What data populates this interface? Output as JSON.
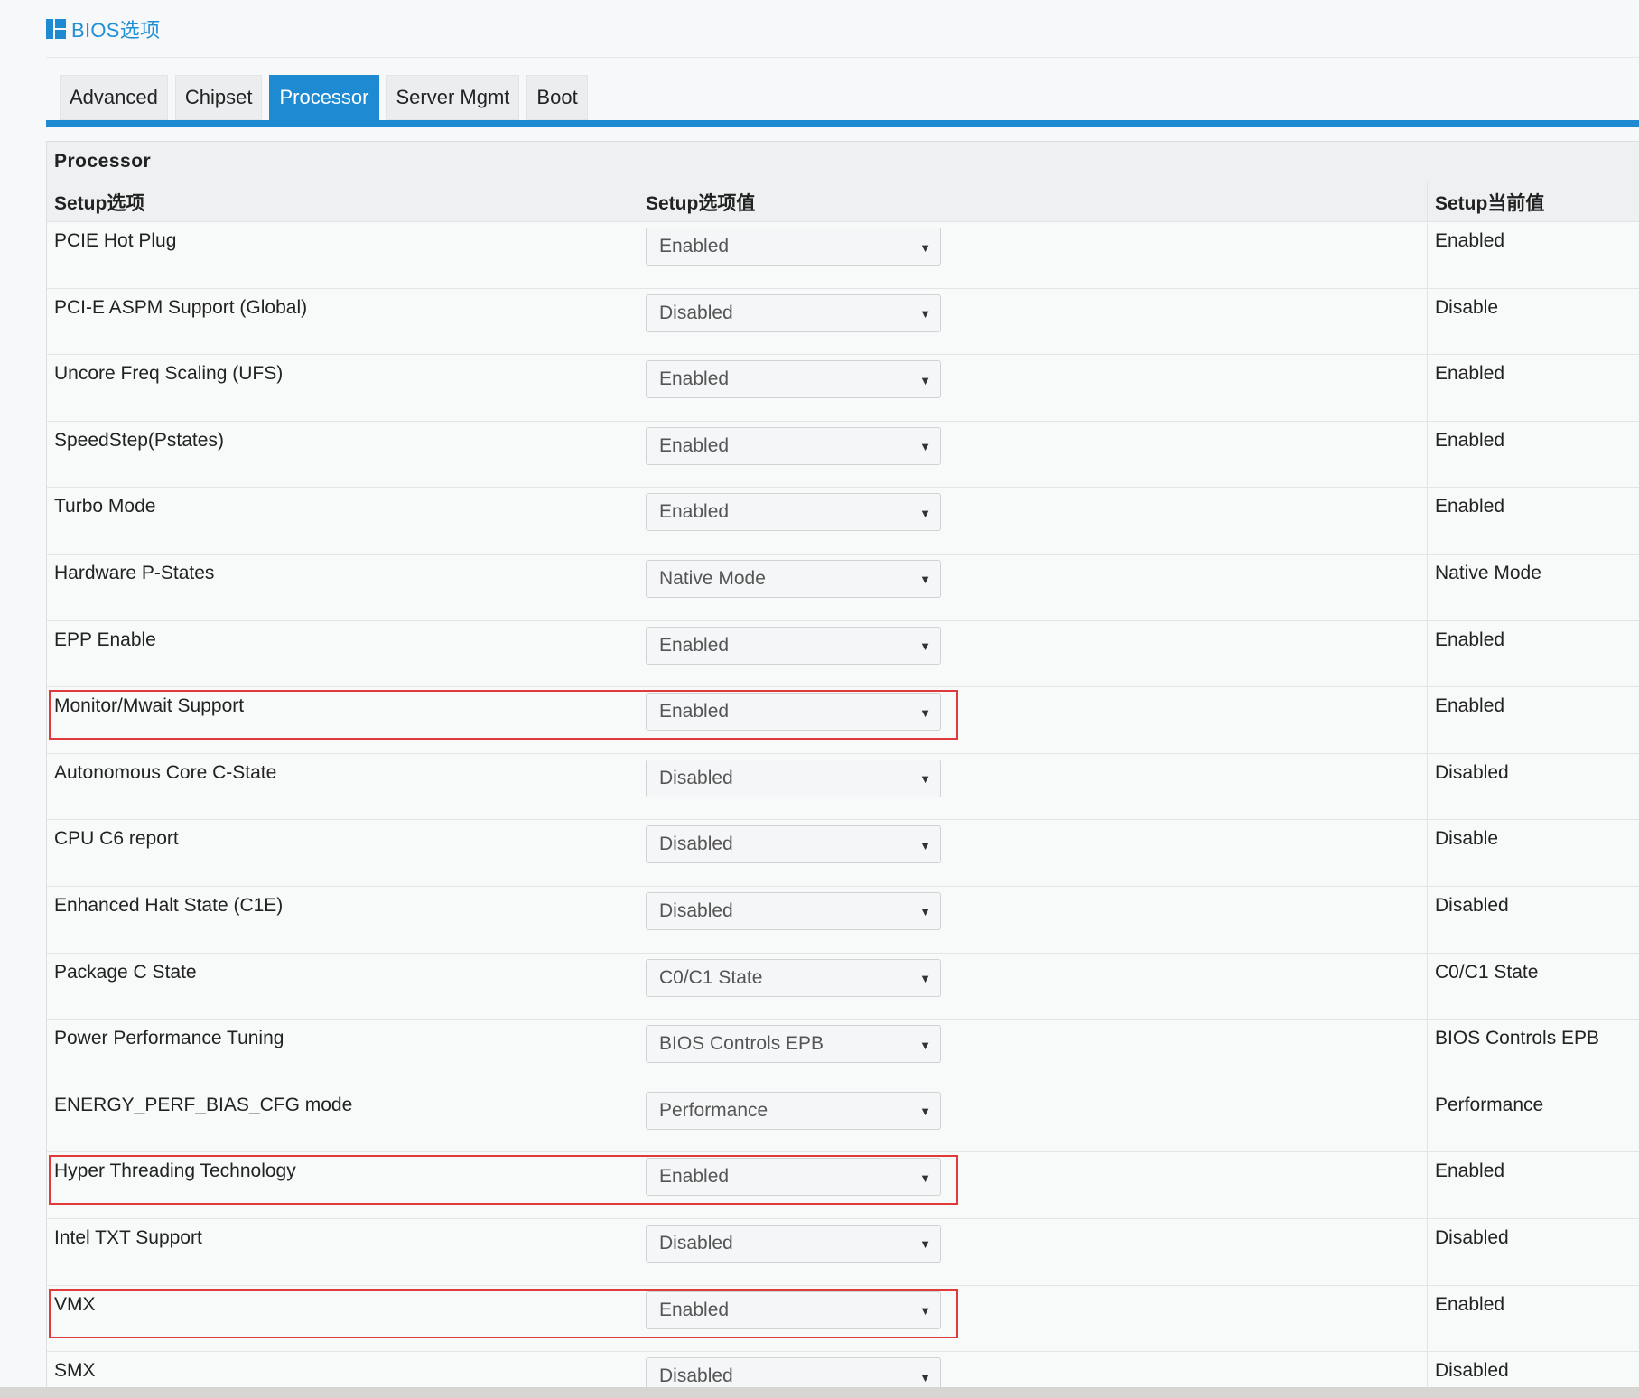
{
  "page": {
    "title": "BIOS选项"
  },
  "tabs": [
    {
      "label": "Advanced",
      "active": false
    },
    {
      "label": "Chipset",
      "active": false
    },
    {
      "label": "Processor",
      "active": true
    },
    {
      "label": "Server Mgmt",
      "active": false
    },
    {
      "label": "Boot",
      "active": false
    }
  ],
  "section": {
    "title": "Processor"
  },
  "table": {
    "headers": {
      "option": "Setup选项",
      "value": "Setup选项值",
      "current": "Setup当前值"
    },
    "rows": [
      {
        "name": "PCIE Hot Plug",
        "value": "Enabled",
        "current": "Enabled",
        "highlighted": false
      },
      {
        "name": "PCI-E ASPM Support (Global)",
        "value": "Disabled",
        "current": "Disable",
        "highlighted": false
      },
      {
        "name": "Uncore Freq Scaling (UFS)",
        "value": "Enabled",
        "current": "Enabled",
        "highlighted": false
      },
      {
        "name": "SpeedStep(Pstates)",
        "value": "Enabled",
        "current": "Enabled",
        "highlighted": false
      },
      {
        "name": "Turbo Mode",
        "value": "Enabled",
        "current": "Enabled",
        "highlighted": false
      },
      {
        "name": "Hardware P-States",
        "value": "Native Mode",
        "current": "Native Mode",
        "highlighted": false
      },
      {
        "name": "EPP Enable",
        "value": "Enabled",
        "current": "Enabled",
        "highlighted": false
      },
      {
        "name": "Monitor/Mwait Support",
        "value": "Enabled",
        "current": "Enabled",
        "highlighted": true
      },
      {
        "name": "Autonomous Core C-State",
        "value": "Disabled",
        "current": "Disabled",
        "highlighted": false
      },
      {
        "name": "CPU C6 report",
        "value": "Disabled",
        "current": "Disable",
        "highlighted": false
      },
      {
        "name": "Enhanced Halt State (C1E)",
        "value": "Disabled",
        "current": "Disabled",
        "highlighted": false
      },
      {
        "name": "Package C State",
        "value": "C0/C1 State",
        "current": "C0/C1 State",
        "highlighted": false
      },
      {
        "name": "Power Performance Tuning",
        "value": "BIOS Controls EPB",
        "current": "BIOS Controls EPB",
        "highlighted": false
      },
      {
        "name": "ENERGY_PERF_BIAS_CFG mode",
        "value": "Performance",
        "current": "Performance",
        "highlighted": false
      },
      {
        "name": "Hyper Threading Technology",
        "value": "Enabled",
        "current": "Enabled",
        "highlighted": true
      },
      {
        "name": "Intel TXT Support",
        "value": "Disabled",
        "current": "Disabled",
        "highlighted": false
      },
      {
        "name": "VMX",
        "value": "Enabled",
        "current": "Enabled",
        "highlighted": true
      },
      {
        "name": "SMX",
        "value": "Disabled",
        "current": "Disabled",
        "highlighted": false
      }
    ]
  },
  "colors": {
    "accent": "#1d8ad2",
    "title_text": "#1f8fd6",
    "highlight_border": "#e03b3b"
  },
  "icons": {
    "title_icon": "layout-panels-icon",
    "dropdown_arrow": "caret-down-icon"
  }
}
